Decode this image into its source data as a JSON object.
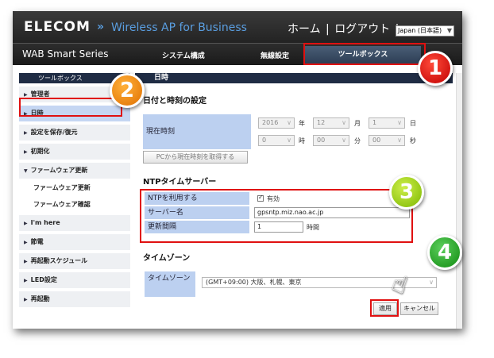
{
  "header": {
    "logo": "ELECOM",
    "separator": "»",
    "product": "Wireless AP for Business",
    "nav_home": "ホーム",
    "nav_divider": "|",
    "nav_logout": "ログアウト",
    "nav_divider2": "|",
    "language": "Japan (日本語)"
  },
  "tabbar": {
    "series": "WAB Smart Series",
    "tab_system": "システム構成",
    "tab_wireless": "無線設定",
    "tab_tools": "ツールボックス"
  },
  "sidebar": {
    "title": "ツールボックス",
    "items": [
      {
        "label": "管理者"
      },
      {
        "label": "日時"
      },
      {
        "label": "設定を保存/復元"
      },
      {
        "label": "初期化"
      },
      {
        "label": "ファームウェア更新"
      },
      {
        "label": "ファームウェア更新"
      },
      {
        "label": "ファームウェア確認"
      },
      {
        "label": "I'm here"
      },
      {
        "label": "節電"
      },
      {
        "label": "再起動スケジュール"
      },
      {
        "label": "LED設定"
      },
      {
        "label": "再起動"
      }
    ]
  },
  "page": {
    "title": "日時",
    "datetime_section": "日付と時刻の設定",
    "current_time_label": "現在時刻",
    "year": "2016",
    "year_unit": "年",
    "month": "12",
    "month_unit": "月",
    "day": "1",
    "day_unit": "日",
    "hour": "0",
    "hour_unit": "時",
    "minute": "00",
    "minute_unit": "分",
    "second": "00",
    "second_unit": "秒",
    "get_pc_time_button": "PCから現在時刻を取得する",
    "ntp_section": "NTPタイムサーバー",
    "ntp_use_label": "NTPを利用する",
    "ntp_use_value": "有効",
    "server_label": "サーバー名",
    "server_value": "gpsntp.miz.nao.ac.jp",
    "interval_label": "更新間隔",
    "interval_value": "1",
    "interval_unit": "時間",
    "timezone_section": "タイムゾーン",
    "timezone_label": "タイムゾーン",
    "timezone_value": "(GMT+09:00) 大阪、札幌、東京",
    "apply_button": "適用",
    "cancel_button": "キャンセル"
  },
  "badges": [
    "1",
    "2",
    "3",
    "4"
  ],
  "colors": {
    "highlight": "#e01010",
    "label_bg": "#bcd0f0",
    "header_bg": "#1f2c44",
    "product_blue": "#5a9ee0"
  }
}
